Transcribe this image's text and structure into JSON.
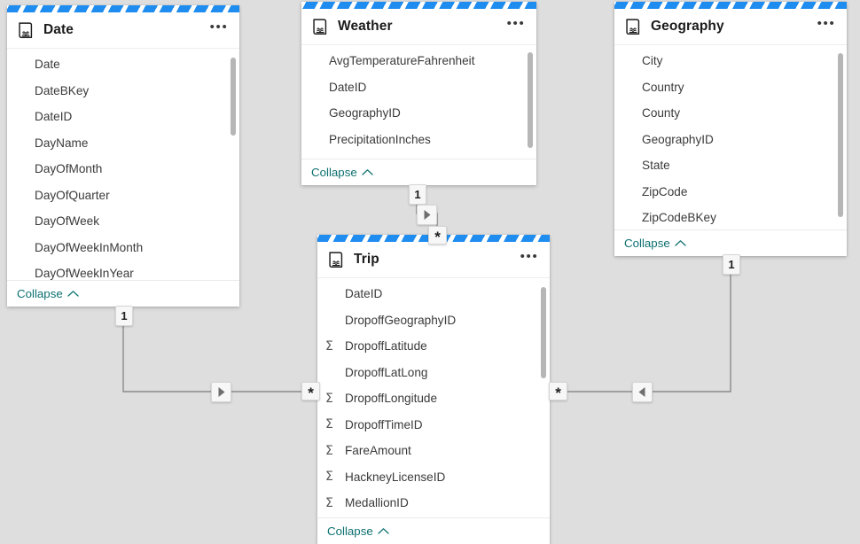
{
  "canvas": {
    "background": "#dedede",
    "accent_stripe": "#1f8cf0",
    "collapse_color": "#0d7070"
  },
  "tables": [
    {
      "id": "date",
      "title": "Date",
      "icon": "table-data-icon",
      "menu_label": "•••",
      "collapse_label": "Collapse",
      "fields": [
        {
          "name": "Date",
          "measure": false
        },
        {
          "name": "DateBKey",
          "measure": false
        },
        {
          "name": "DateID",
          "measure": false
        },
        {
          "name": "DayName",
          "measure": false
        },
        {
          "name": "DayOfMonth",
          "measure": false
        },
        {
          "name": "DayOfQuarter",
          "measure": false
        },
        {
          "name": "DayOfWeek",
          "measure": false
        },
        {
          "name": "DayOfWeekInMonth",
          "measure": false
        },
        {
          "name": "DayOfWeekInYear",
          "measure": false
        }
      ]
    },
    {
      "id": "weather",
      "title": "Weather",
      "icon": "table-data-icon",
      "menu_label": "•••",
      "collapse_label": "Collapse",
      "fields": [
        {
          "name": "AvgTemperatureFahrenheit",
          "measure": false
        },
        {
          "name": "DateID",
          "measure": false
        },
        {
          "name": "GeographyID",
          "measure": false
        },
        {
          "name": "PrecipitationInches",
          "measure": false
        }
      ]
    },
    {
      "id": "geography",
      "title": "Geography",
      "icon": "table-data-icon",
      "menu_label": "•••",
      "collapse_label": "Collapse",
      "fields": [
        {
          "name": "City",
          "measure": false
        },
        {
          "name": "Country",
          "measure": false
        },
        {
          "name": "County",
          "measure": false
        },
        {
          "name": "GeographyID",
          "measure": false
        },
        {
          "name": "State",
          "measure": false
        },
        {
          "name": "ZipCode",
          "measure": false
        },
        {
          "name": "ZipCodeBKey",
          "measure": false
        }
      ]
    },
    {
      "id": "trip",
      "title": "Trip",
      "icon": "table-data-icon",
      "menu_label": "•••",
      "collapse_label": "Collapse",
      "fields": [
        {
          "name": "DateID",
          "measure": false
        },
        {
          "name": "DropoffGeographyID",
          "measure": false
        },
        {
          "name": "DropoffLatitude",
          "measure": true
        },
        {
          "name": "DropoffLatLong",
          "measure": false
        },
        {
          "name": "DropoffLongitude",
          "measure": true
        },
        {
          "name": "DropoffTimeID",
          "measure": true
        },
        {
          "name": "FareAmount",
          "measure": true
        },
        {
          "name": "HackneyLicenseID",
          "measure": true
        },
        {
          "name": "MedallionID",
          "measure": true
        }
      ]
    }
  ],
  "relationships": [
    {
      "id": "date-trip",
      "from": "Date",
      "to": "Trip",
      "from_cardinality": "1",
      "to_cardinality": "*",
      "direction": "right"
    },
    {
      "id": "weather-trip",
      "from": "Weather",
      "to": "Trip",
      "from_cardinality": "1",
      "to_cardinality": "*",
      "direction": "right"
    },
    {
      "id": "geography-trip",
      "from": "Geography",
      "to": "Trip",
      "from_cardinality": "1",
      "to_cardinality": "*",
      "direction": "left"
    }
  ],
  "sigma_glyph": "Σ",
  "star_glyph": "✱"
}
